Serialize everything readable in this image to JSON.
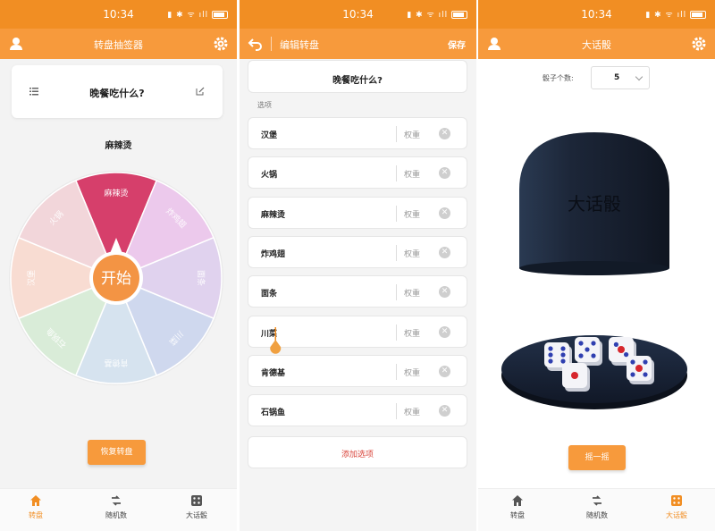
{
  "status": {
    "time": "10:34"
  },
  "screen1": {
    "title": "转盘抽签器",
    "question": "晚餐吃什么?",
    "result": "麻辣烫",
    "start_label": "开始",
    "reset_label": "恢复转盘",
    "wheel": {
      "slices": [
        {
          "label": "麻辣烫",
          "color": "#d63f6b"
        },
        {
          "label": "炸鸡翅",
          "color": "#ecc9ec"
        },
        {
          "label": "面条",
          "color": "#e0d2ee"
        },
        {
          "label": "川菜",
          "color": "#cfd8ee"
        },
        {
          "label": "肯德基",
          "color": "#d6e3ef"
        },
        {
          "label": "石锅鱼",
          "color": "#d9ecd8"
        },
        {
          "label": "汉堡",
          "color": "#f8dcd2"
        },
        {
          "label": "火锅",
          "color": "#f2d6da"
        }
      ]
    }
  },
  "screen2": {
    "title": "编辑转盘",
    "save_label": "保存",
    "question": "晚餐吃什么?",
    "section_label": "选项",
    "weight_placeholder": "权重",
    "options": [
      "汉堡",
      "火锅",
      "麻辣烫",
      "炸鸡翅",
      "面条",
      "川菜",
      "肯德基",
      "石锅鱼"
    ],
    "add_label": "添加选项"
  },
  "screen3": {
    "title": "大话骰",
    "dice_count_label": "骰子个数:",
    "dice_count": "5",
    "cup_label": "大话骰",
    "shake_label": "摇一摇"
  },
  "tabs": [
    {
      "label": "转盘",
      "icon": "home-icon"
    },
    {
      "label": "随机数",
      "icon": "shuffle-icon"
    },
    {
      "label": "大话骰",
      "icon": "dice-icon"
    }
  ],
  "colors": {
    "accent": "#f79a3c",
    "statusbar": "#f18e23",
    "delete": "#d9453b"
  }
}
